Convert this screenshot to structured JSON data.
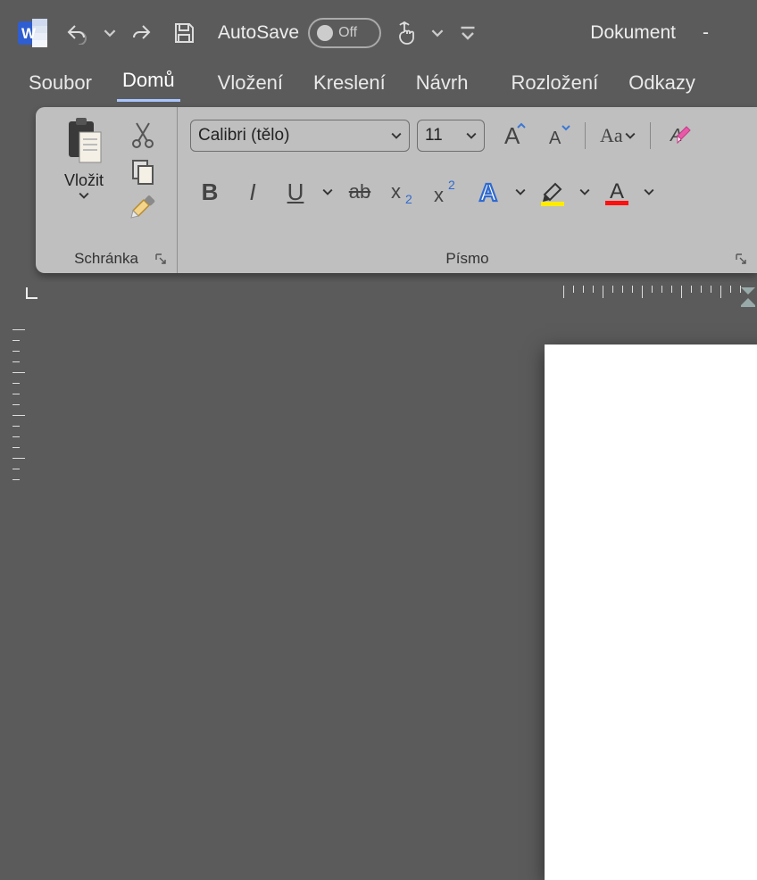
{
  "title_bar": {
    "autosave_label": "AutoSave",
    "autosave_state": "Off",
    "document_name": "Dokument",
    "dash": "-"
  },
  "tabs": {
    "soubor": "Soubor",
    "domu": "Domů",
    "vlozeni": "Vložení",
    "kresleni": "Kreslení",
    "navrh": "Návrh",
    "rozlozeni": "Rozložení",
    "odkazy": "Odkazy"
  },
  "ribbon": {
    "clipboard": {
      "paste_label": "Vložit",
      "group_label": "Schránka"
    },
    "font": {
      "font_name": "Calibri (tělo)",
      "font_size": "11",
      "aa_label": "Aa",
      "group_label": "Písmo"
    }
  }
}
